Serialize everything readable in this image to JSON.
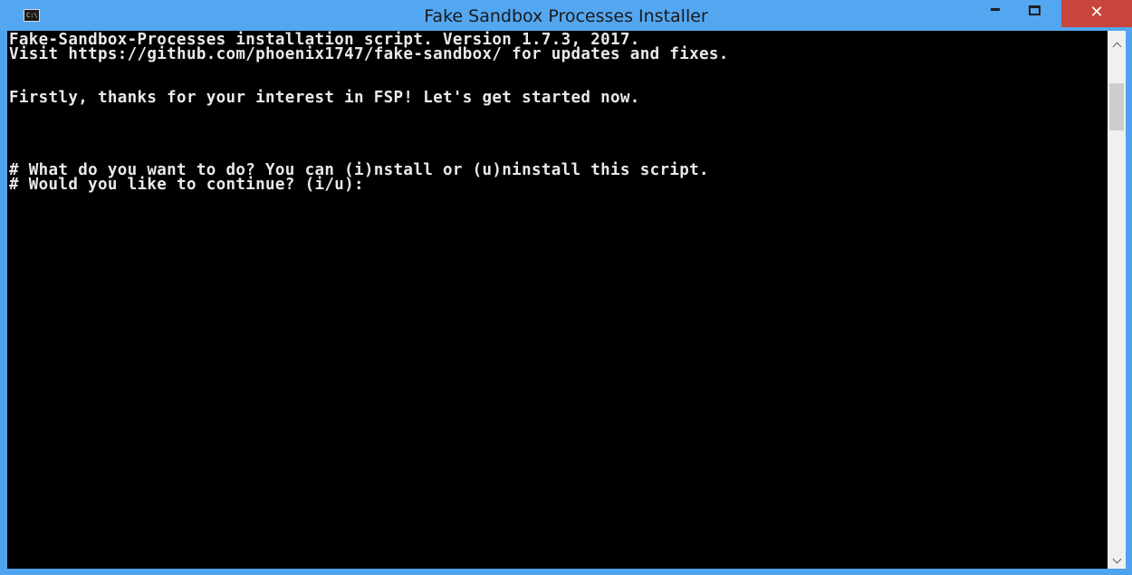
{
  "window": {
    "title": "Fake Sandbox Processes Installer",
    "icon": "cmd-console-icon",
    "icon_text": "C:\\.",
    "controls": {
      "minimize": "minimize-icon",
      "maximize": "maximize-icon",
      "close": "close-icon",
      "close_glyph": "✕"
    }
  },
  "console": {
    "background": "#000000",
    "foreground": "#e9e9e9",
    "lines": [
      "Fake-Sandbox-Processes installation script. Version 1.7.3, 2017.",
      "Visit https://github.com/phoenix1747/fake-sandbox/ for updates and fixes.",
      "",
      "",
      "Firstly, thanks for your interest in FSP! Let's get started now.",
      "",
      "",
      "",
      "",
      "# What do you want to do? You can (i)nstall or (u)ninstall this script.",
      "# Would you like to continue? (i/u):"
    ]
  },
  "scrollbar": {
    "up_icon": "chevron-up-icon",
    "down_icon": "chevron-down-icon"
  },
  "colors": {
    "titlebar": "#53a6f0",
    "close_button": "#c7453a",
    "scrollbar_track": "#f0f0f0"
  }
}
